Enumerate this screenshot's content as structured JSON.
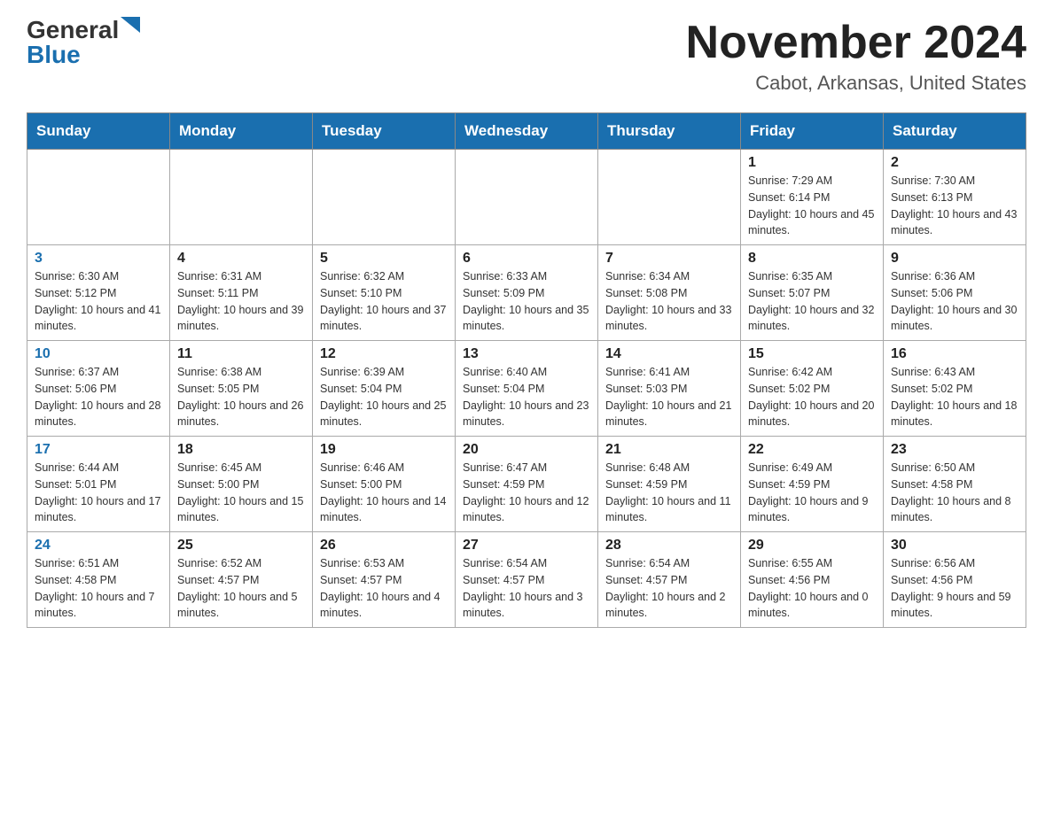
{
  "header": {
    "logo_general": "General",
    "logo_blue": "Blue",
    "title": "November 2024",
    "subtitle": "Cabot, Arkansas, United States"
  },
  "days_of_week": [
    "Sunday",
    "Monday",
    "Tuesday",
    "Wednesday",
    "Thursday",
    "Friday",
    "Saturday"
  ],
  "weeks": [
    [
      {
        "day": "",
        "info": ""
      },
      {
        "day": "",
        "info": ""
      },
      {
        "day": "",
        "info": ""
      },
      {
        "day": "",
        "info": ""
      },
      {
        "day": "",
        "info": ""
      },
      {
        "day": "1",
        "info": "Sunrise: 7:29 AM\nSunset: 6:14 PM\nDaylight: 10 hours and 45 minutes."
      },
      {
        "day": "2",
        "info": "Sunrise: 7:30 AM\nSunset: 6:13 PM\nDaylight: 10 hours and 43 minutes."
      }
    ],
    [
      {
        "day": "3",
        "info": "Sunrise: 6:30 AM\nSunset: 5:12 PM\nDaylight: 10 hours and 41 minutes."
      },
      {
        "day": "4",
        "info": "Sunrise: 6:31 AM\nSunset: 5:11 PM\nDaylight: 10 hours and 39 minutes."
      },
      {
        "day": "5",
        "info": "Sunrise: 6:32 AM\nSunset: 5:10 PM\nDaylight: 10 hours and 37 minutes."
      },
      {
        "day": "6",
        "info": "Sunrise: 6:33 AM\nSunset: 5:09 PM\nDaylight: 10 hours and 35 minutes."
      },
      {
        "day": "7",
        "info": "Sunrise: 6:34 AM\nSunset: 5:08 PM\nDaylight: 10 hours and 33 minutes."
      },
      {
        "day": "8",
        "info": "Sunrise: 6:35 AM\nSunset: 5:07 PM\nDaylight: 10 hours and 32 minutes."
      },
      {
        "day": "9",
        "info": "Sunrise: 6:36 AM\nSunset: 5:06 PM\nDaylight: 10 hours and 30 minutes."
      }
    ],
    [
      {
        "day": "10",
        "info": "Sunrise: 6:37 AM\nSunset: 5:06 PM\nDaylight: 10 hours and 28 minutes."
      },
      {
        "day": "11",
        "info": "Sunrise: 6:38 AM\nSunset: 5:05 PM\nDaylight: 10 hours and 26 minutes."
      },
      {
        "day": "12",
        "info": "Sunrise: 6:39 AM\nSunset: 5:04 PM\nDaylight: 10 hours and 25 minutes."
      },
      {
        "day": "13",
        "info": "Sunrise: 6:40 AM\nSunset: 5:04 PM\nDaylight: 10 hours and 23 minutes."
      },
      {
        "day": "14",
        "info": "Sunrise: 6:41 AM\nSunset: 5:03 PM\nDaylight: 10 hours and 21 minutes."
      },
      {
        "day": "15",
        "info": "Sunrise: 6:42 AM\nSunset: 5:02 PM\nDaylight: 10 hours and 20 minutes."
      },
      {
        "day": "16",
        "info": "Sunrise: 6:43 AM\nSunset: 5:02 PM\nDaylight: 10 hours and 18 minutes."
      }
    ],
    [
      {
        "day": "17",
        "info": "Sunrise: 6:44 AM\nSunset: 5:01 PM\nDaylight: 10 hours and 17 minutes."
      },
      {
        "day": "18",
        "info": "Sunrise: 6:45 AM\nSunset: 5:00 PM\nDaylight: 10 hours and 15 minutes."
      },
      {
        "day": "19",
        "info": "Sunrise: 6:46 AM\nSunset: 5:00 PM\nDaylight: 10 hours and 14 minutes."
      },
      {
        "day": "20",
        "info": "Sunrise: 6:47 AM\nSunset: 4:59 PM\nDaylight: 10 hours and 12 minutes."
      },
      {
        "day": "21",
        "info": "Sunrise: 6:48 AM\nSunset: 4:59 PM\nDaylight: 10 hours and 11 minutes."
      },
      {
        "day": "22",
        "info": "Sunrise: 6:49 AM\nSunset: 4:59 PM\nDaylight: 10 hours and 9 minutes."
      },
      {
        "day": "23",
        "info": "Sunrise: 6:50 AM\nSunset: 4:58 PM\nDaylight: 10 hours and 8 minutes."
      }
    ],
    [
      {
        "day": "24",
        "info": "Sunrise: 6:51 AM\nSunset: 4:58 PM\nDaylight: 10 hours and 7 minutes."
      },
      {
        "day": "25",
        "info": "Sunrise: 6:52 AM\nSunset: 4:57 PM\nDaylight: 10 hours and 5 minutes."
      },
      {
        "day": "26",
        "info": "Sunrise: 6:53 AM\nSunset: 4:57 PM\nDaylight: 10 hours and 4 minutes."
      },
      {
        "day": "27",
        "info": "Sunrise: 6:54 AM\nSunset: 4:57 PM\nDaylight: 10 hours and 3 minutes."
      },
      {
        "day": "28",
        "info": "Sunrise: 6:54 AM\nSunset: 4:57 PM\nDaylight: 10 hours and 2 minutes."
      },
      {
        "day": "29",
        "info": "Sunrise: 6:55 AM\nSunset: 4:56 PM\nDaylight: 10 hours and 0 minutes."
      },
      {
        "day": "30",
        "info": "Sunrise: 6:56 AM\nSunset: 4:56 PM\nDaylight: 9 hours and 59 minutes."
      }
    ]
  ]
}
